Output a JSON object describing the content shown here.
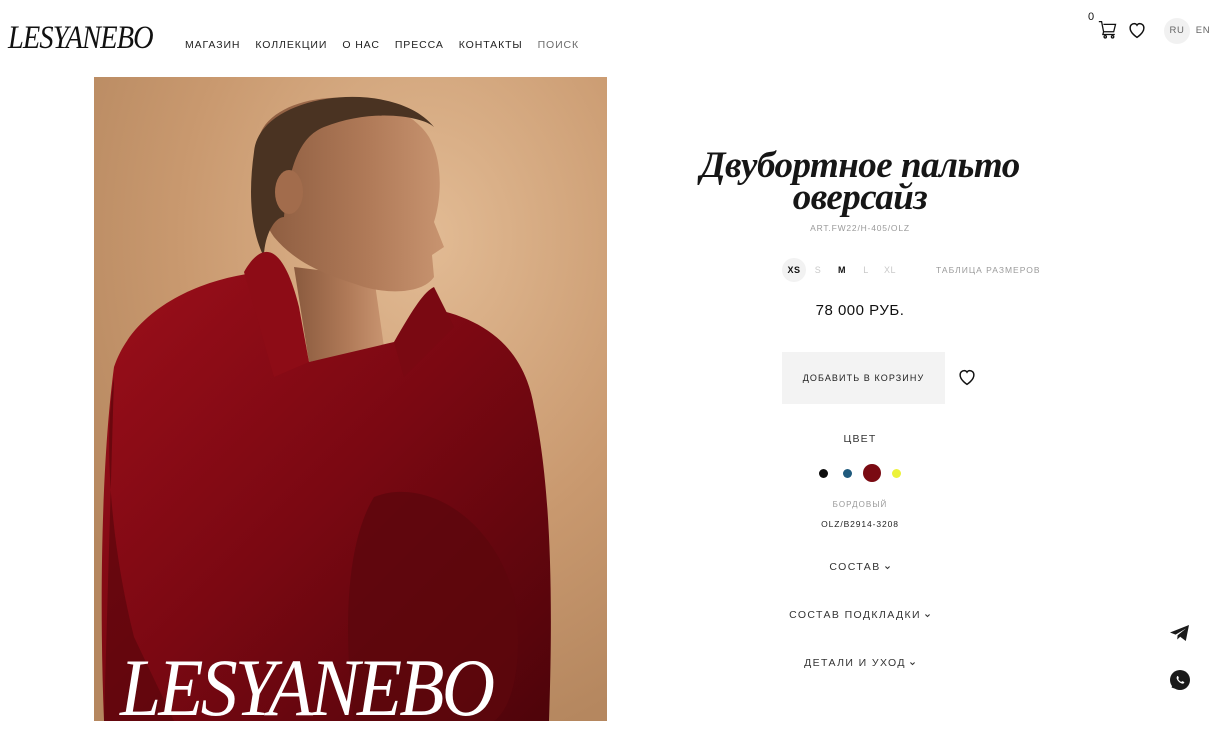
{
  "header": {
    "logo": "LESYANEBO",
    "nav": [
      "МАГАЗИН",
      "КОЛЛЕКЦИИ",
      "О НАС",
      "ПРЕССА",
      "КОНТАКТЫ",
      "ПОИСК"
    ],
    "cart_count": "0",
    "languages": [
      "RU",
      "EN"
    ],
    "active_language": "RU"
  },
  "hero": {
    "overlay_logo": "LESYANEBO"
  },
  "product": {
    "title_line1": "Двубортное пальто",
    "title_line2": "оверсайз",
    "article": "ART.FW22/H-405/OLZ",
    "sizes": [
      "XS",
      "S",
      "M",
      "L",
      "XL"
    ],
    "selected_size": "XS",
    "size_table_label": "ТАБЛИЦА РАЗМЕРОВ",
    "price": "78 000 РУБ.",
    "add_to_cart_label": "ДОБАВИТЬ В КОРЗИНУ",
    "color_heading": "ЦВЕТ",
    "swatches": [
      {
        "color": "#0d0d0d"
      },
      {
        "color": "#1f5a7d"
      },
      {
        "color": "#7a0a12"
      },
      {
        "color": "#ecf23a"
      }
    ],
    "selected_color_name": "БОРДОВЫЙ",
    "color_code": "OLZ/B2914-3208",
    "accordions": [
      "СОСТАВ",
      "СОСТАВ ПОДКЛАДКИ",
      "ДЕТАЛИ И УХОД"
    ]
  },
  "icons": {
    "cart": "cart-icon",
    "favorite": "heart-icon",
    "telegram": "telegram-icon",
    "whatsapp": "whatsapp-icon"
  }
}
